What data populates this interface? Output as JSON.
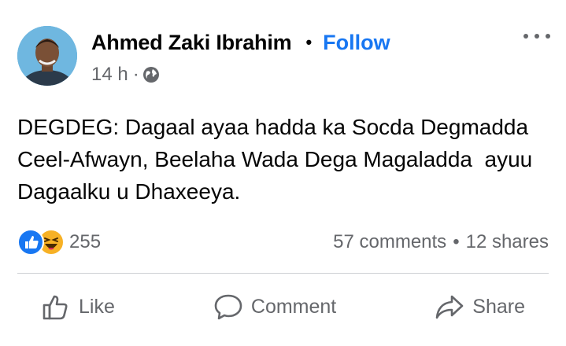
{
  "post": {
    "author": "Ahmed Zaki Ibrahim",
    "separator": "•",
    "follow_label": "Follow",
    "time": "14 h",
    "meta_sep": "·",
    "audience_icon": "globe-icon",
    "more_icon": "more-options-icon",
    "text": "DEGDEG: Dagaal ayaa hadda ka Socda Degmadda Ceel-Afwayn, Beelaha Wada Dega Magaladda  ayuu Dagaalku u Dhaxeeya."
  },
  "reactions": {
    "icons": [
      "like-reaction-icon",
      "haha-reaction-icon"
    ],
    "count": "255"
  },
  "stats": {
    "comments": "57 comments",
    "bullet": "•",
    "shares": "12 shares"
  },
  "actions": {
    "like": "Like",
    "comment": "Comment",
    "share": "Share"
  },
  "colors": {
    "follow_blue": "#1877f2",
    "secondary_text": "#65676b",
    "divider": "#ced0d4",
    "haha_yellow": "#f7b125"
  }
}
